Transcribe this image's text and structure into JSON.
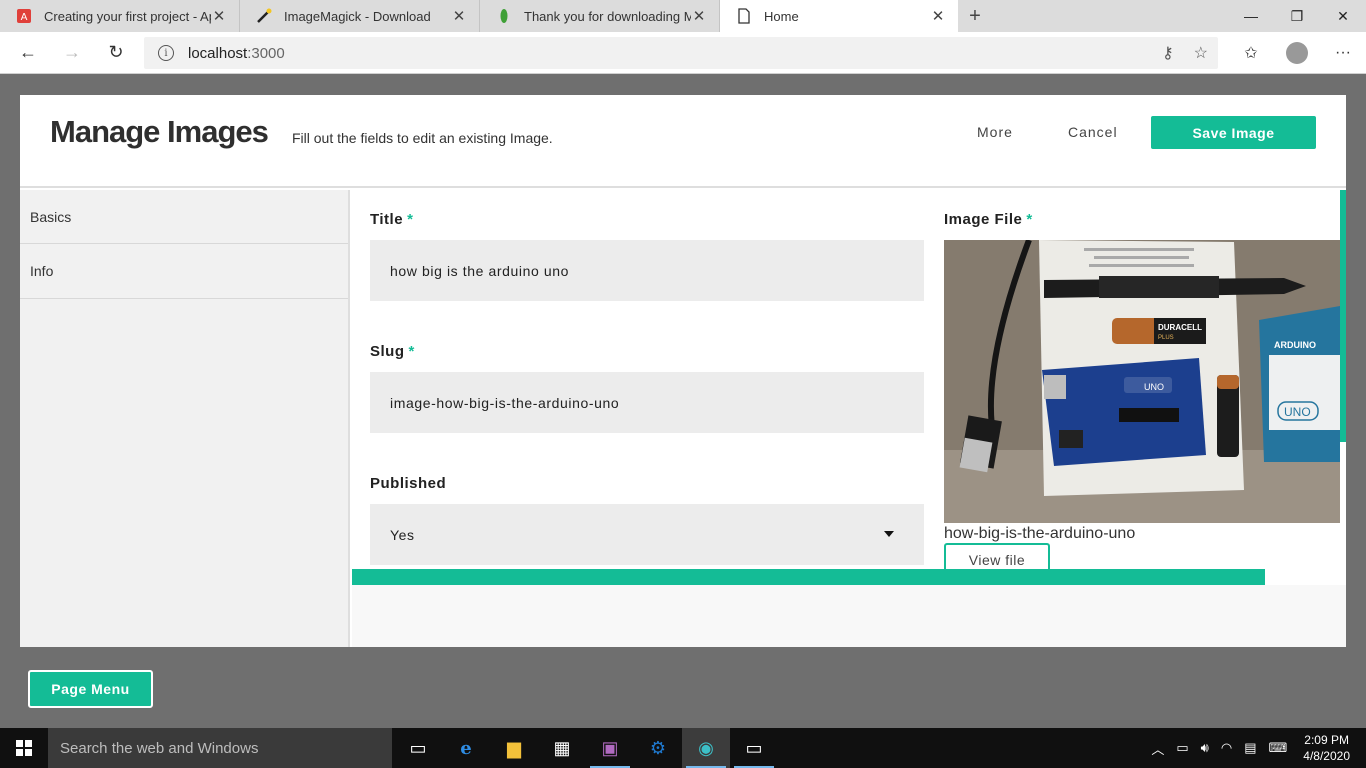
{
  "browser": {
    "tabs": [
      {
        "title": "Creating your first project - Apos",
        "icon": "apostrophe-icon"
      },
      {
        "title": "ImageMagick - Download",
        "icon": "imagemagick-icon"
      },
      {
        "title": "Thank you for downloading Mon",
        "icon": "mongodb-leaf-icon"
      },
      {
        "title": "Home",
        "icon": "page-icon"
      }
    ],
    "url_host": "localhost",
    "url_port": ":3000"
  },
  "modal": {
    "title": "Manage Images",
    "subtitle": "Fill out the fields to edit an existing Image.",
    "more_label": "More",
    "cancel_label": "Cancel",
    "save_label": "Save Image",
    "sidebar": [
      {
        "label": "Basics"
      },
      {
        "label": "Info"
      }
    ],
    "fields": {
      "title_label": "Title",
      "title_value": "how big is the arduino uno",
      "slug_label": "Slug",
      "slug_value": "image-how-big-is-the-arduino-uno",
      "published_label": "Published",
      "published_value": "Yes",
      "image_file_label": "Image File",
      "required_mark": "*"
    },
    "image": {
      "filename": "how-big-is-the-arduino-uno",
      "view_file_label": "View file",
      "battery_brand": "DURACELL",
      "battery_sub": "PLUS",
      "box_brand": "ARDUINO",
      "box_model": "UNO",
      "board_logo": "UNO"
    }
  },
  "page_menu_label": "Page Menu",
  "taskbar": {
    "search_placeholder": "Search the web and Windows",
    "time": "2:09 PM",
    "date": "4/8/2020"
  },
  "colors": {
    "accent": "#14bc96",
    "overlay": "#6f6f6f"
  }
}
